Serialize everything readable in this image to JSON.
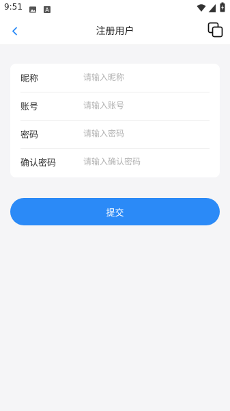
{
  "status_bar": {
    "time": "9:51",
    "left_icons": [
      "image-icon",
      "font-icon"
    ],
    "right_icons": [
      "wifi-icon",
      "signal-icon",
      "battery-icon"
    ]
  },
  "app_bar": {
    "title": "注册用户",
    "back_icon": "chevron-left-icon",
    "action_icon": "copy-icon",
    "accent_color": "#2b8af7"
  },
  "form": {
    "fields": [
      {
        "label": "昵称",
        "placeholder": "请输入昵称",
        "value": ""
      },
      {
        "label": "账号",
        "placeholder": "请输入账号",
        "value": ""
      },
      {
        "label": "密码",
        "placeholder": "请输入密码",
        "value": ""
      },
      {
        "label": "确认密码",
        "placeholder": "请输入确认密码",
        "value": ""
      }
    ]
  },
  "submit": {
    "label": "提交",
    "color": "#2b8af7"
  }
}
